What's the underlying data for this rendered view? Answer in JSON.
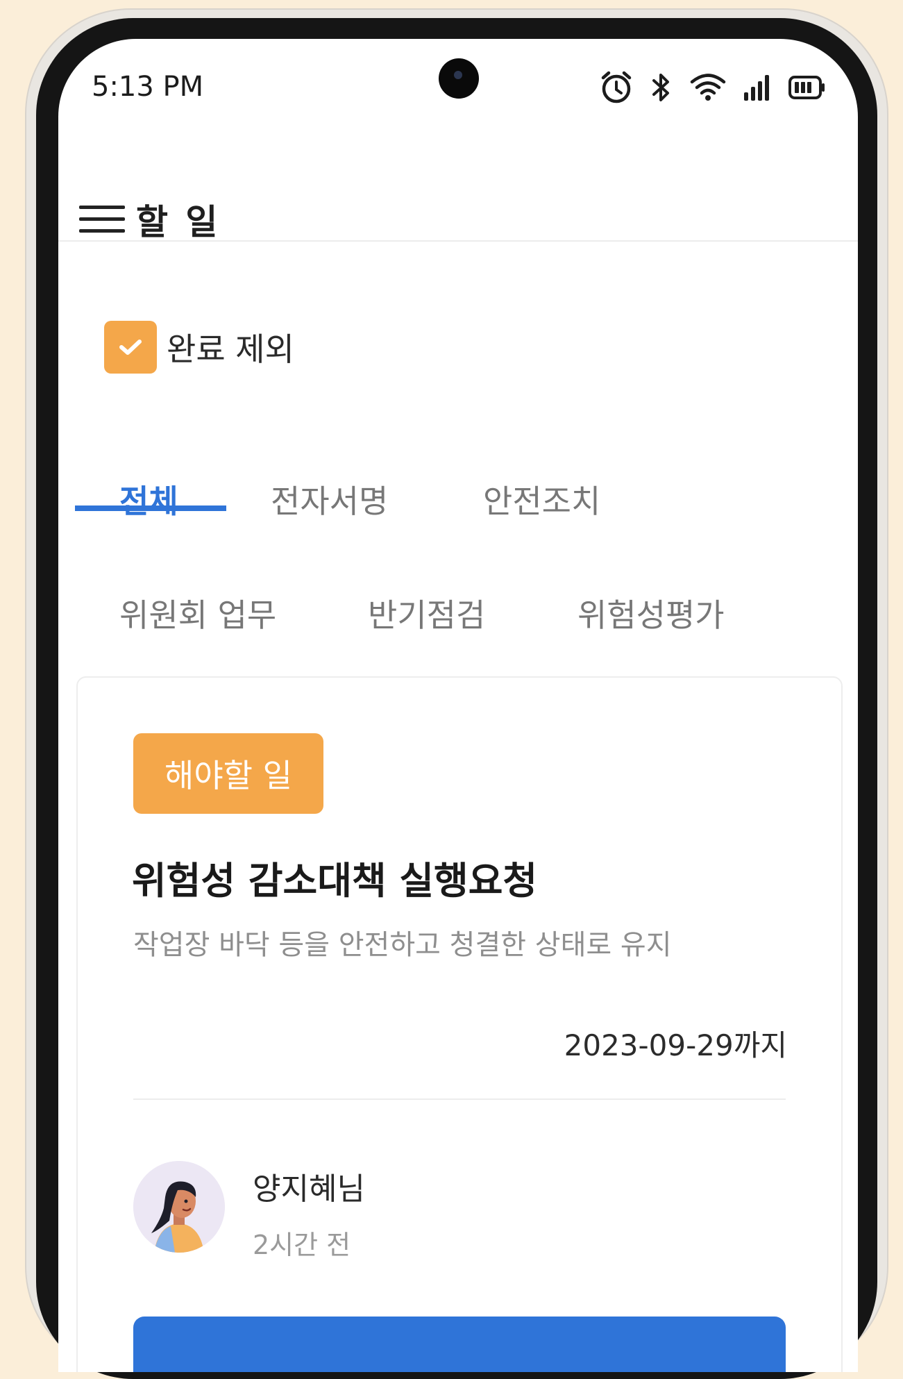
{
  "status_bar": {
    "time": "5:13 PM",
    "icons": [
      "alarm-icon",
      "bluetooth-icon",
      "wifi-icon",
      "signal-icon",
      "battery-icon"
    ]
  },
  "app_bar": {
    "title": "할 일",
    "menu_icon": "hamburger-menu-icon"
  },
  "filter": {
    "label": "완료 제외",
    "checked": true
  },
  "tabs": {
    "row1": [
      "전체",
      "전자서명",
      "안전조치"
    ],
    "row2": [
      "위원회 업무",
      "반기점검",
      "위험성평가"
    ],
    "active": "전체"
  },
  "task_card": {
    "status": "해야할 일",
    "title": "위험성 감소대책 실행요청",
    "description": "작업장 바닥 등을 안전하고 청결한 상태로 유지",
    "due": "2023-09-29까지",
    "assignee": {
      "name": "양지혜님",
      "time": "2시간 전"
    }
  },
  "colors": {
    "accent_blue": "#2f74d8",
    "accent_orange": "#f4a74a",
    "background": "#fbeed9"
  }
}
